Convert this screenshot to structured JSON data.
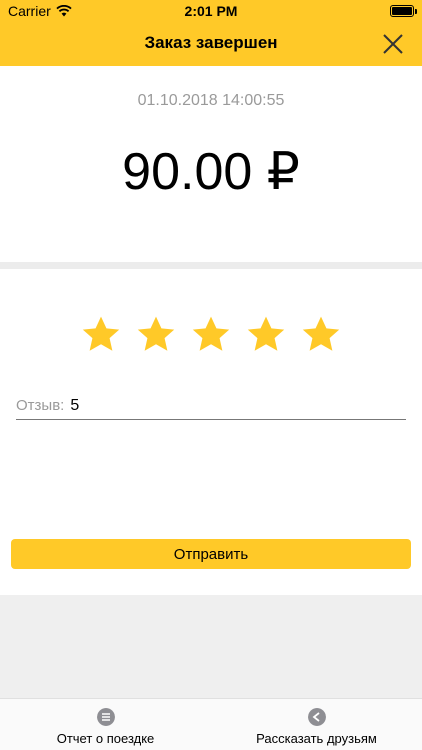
{
  "status_bar": {
    "carrier": "Carrier",
    "time": "2:01 PM",
    "wifi_icon": "wifi-icon",
    "battery_icon": "battery-icon"
  },
  "header": {
    "title": "Заказ завершен",
    "close_icon": "close-icon"
  },
  "order": {
    "datetime": "01.10.2018 14:00:55",
    "amount": "90.00 ₽"
  },
  "rating": {
    "stars_total": 5,
    "stars_filled": 5,
    "star_color": "#FFC928",
    "star_icon": "star-icon"
  },
  "review": {
    "label": "Отзыв:",
    "value": "5"
  },
  "submit": {
    "label": "Отправить"
  },
  "tabs": [
    {
      "label": "Отчет о поездке",
      "icon": "list-icon"
    },
    {
      "label": "Рассказать друзьям",
      "icon": "share-icon"
    }
  ],
  "colors": {
    "accent": "#FFC928",
    "muted_text": "#9a9a9a",
    "band": "#ececec",
    "tab_icon": "#8e8e93"
  }
}
